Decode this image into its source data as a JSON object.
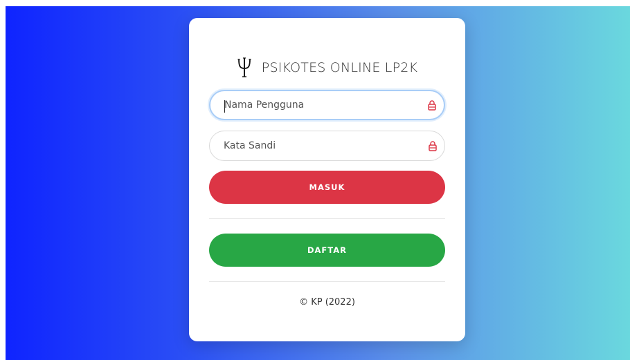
{
  "brand": {
    "icon": "psi-icon",
    "title": "PSIKOTES ONLINE LP2K"
  },
  "form": {
    "username": {
      "placeholder": "Nama Pengguna",
      "value": "",
      "icon": "lock-icon"
    },
    "password": {
      "placeholder": "Kata Sandi",
      "value": "",
      "icon": "lock-icon"
    },
    "login_label": "MASUK",
    "register_label": "DAFTAR"
  },
  "footer": {
    "copyright": "© KP (2022)"
  },
  "colors": {
    "login_button": "#dc3545",
    "register_button": "#28a745",
    "lock_icon": "#dc3545",
    "focus_ring": "#a9cdf7"
  }
}
